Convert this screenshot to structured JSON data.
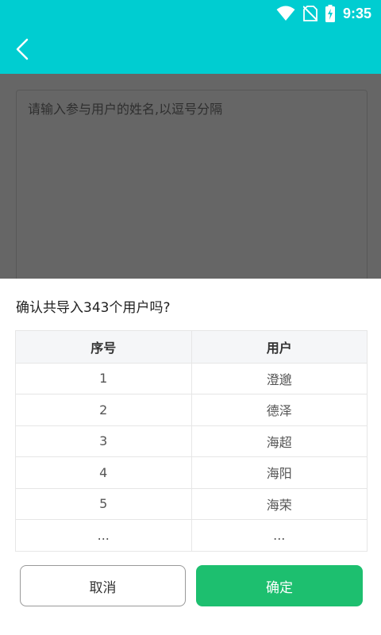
{
  "status_bar": {
    "time": "9:35",
    "icons": [
      "wifi-icon",
      "no-sim-icon",
      "battery-charging-icon"
    ]
  },
  "app_bar": {
    "back_icon": "chevron-left-icon"
  },
  "form": {
    "placeholder": "请输入参与用户的姓名,以逗号分隔"
  },
  "dialog": {
    "title": "确认共导入343个用户吗?",
    "table": {
      "headers": [
        "序号",
        "用户"
      ],
      "rows": [
        [
          "1",
          "澄邈"
        ],
        [
          "2",
          "德泽"
        ],
        [
          "3",
          "海超"
        ],
        [
          "4",
          "海阳"
        ],
        [
          "5",
          "海荣"
        ],
        [
          "...",
          "..."
        ]
      ]
    },
    "cancel_label": "取消",
    "confirm_label": "确定"
  },
  "colors": {
    "primary": "#00cdd1",
    "confirm": "#1dbf6f",
    "overlay": "rgba(0,0,0,0.6)"
  }
}
